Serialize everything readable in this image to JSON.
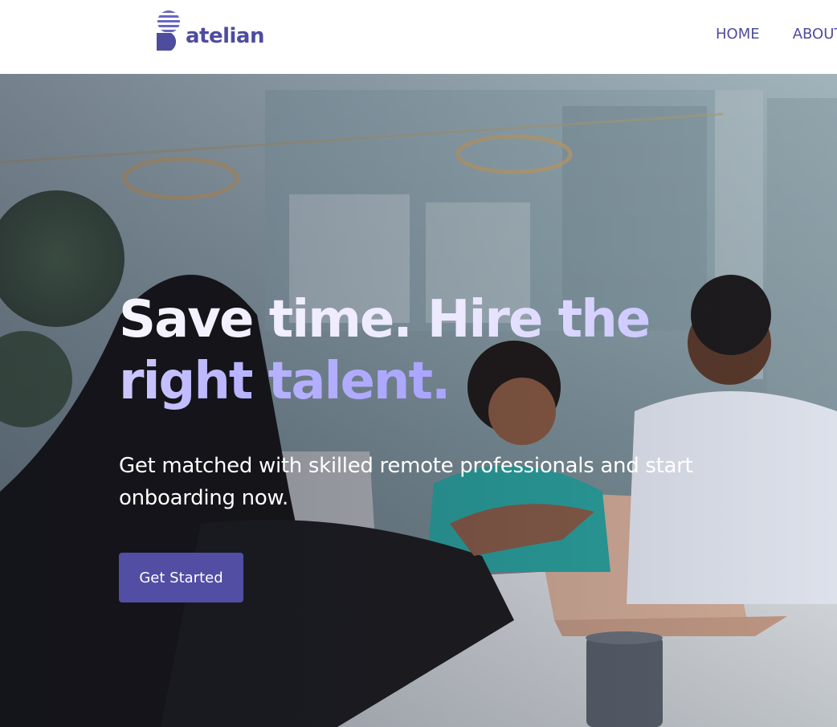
{
  "brand": {
    "name": "atelian",
    "primary_color": "#4e4c9e",
    "logo_icon": "stacked-stripes-d-logo-icon"
  },
  "nav": {
    "items": [
      "HOME",
      "ABOUT"
    ]
  },
  "hero": {
    "headline": "Save time. Hire the right talent.",
    "subheadline": "Get matched with skilled remote professionals and start onboarding now.",
    "cta_label": "Get Started",
    "cta_color": "#514ea3",
    "background_image": "office-meeting-photo"
  }
}
